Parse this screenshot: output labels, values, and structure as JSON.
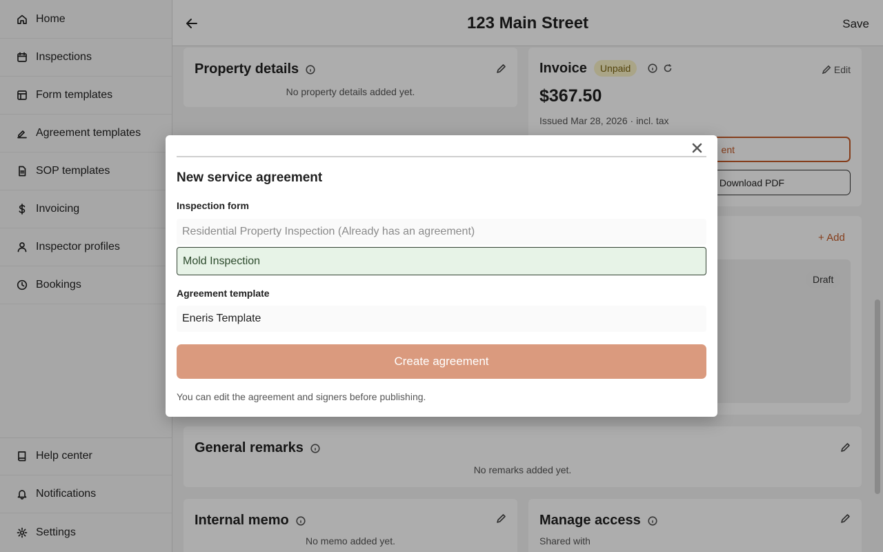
{
  "sidebar": {
    "items": [
      {
        "label": "Home",
        "icon": "home-icon"
      },
      {
        "label": "Inspections",
        "icon": "calendar-icon"
      },
      {
        "label": "Form templates",
        "icon": "layout-icon"
      },
      {
        "label": "Agreement templates",
        "icon": "signature-icon"
      },
      {
        "label": "SOP templates",
        "icon": "document-icon"
      },
      {
        "label": "Invoicing",
        "icon": "dollar-icon"
      },
      {
        "label": "Inspector profiles",
        "icon": "user-icon"
      },
      {
        "label": "Bookings",
        "icon": "clock-icon"
      }
    ],
    "bottom_items": [
      {
        "label": "Help center",
        "icon": "book-icon"
      },
      {
        "label": "Notifications",
        "icon": "bell-icon"
      },
      {
        "label": "Settings",
        "icon": "gear-icon"
      }
    ]
  },
  "topbar": {
    "title": "123 Main Street",
    "save_label": "Save"
  },
  "property_details": {
    "title": "Property details",
    "empty": "No property details added yet."
  },
  "invoice": {
    "title": "Invoice",
    "status": "Unpaid",
    "edit_label": "Edit",
    "amount": "$367.50",
    "meta": "Issued Mar 28, 2026 · incl. tax",
    "action_partial": "ent",
    "download_label": "Download PDF"
  },
  "agreements": {
    "add_label": "+ Add",
    "status": "Draft"
  },
  "general_remarks": {
    "title": "General remarks",
    "empty": "No remarks added yet."
  },
  "internal_memo": {
    "title": "Internal memo",
    "empty": "No memo added yet."
  },
  "manage_access": {
    "title": "Manage access",
    "shared_with": "Shared with"
  },
  "modal": {
    "title": "New service agreement",
    "inspection_form_label": "Inspection form",
    "options": [
      "Residential Property Inspection (Already has an agreement)",
      "Mold Inspection"
    ],
    "template_label": "Agreement template",
    "template_value": "Eneris Template",
    "create_label": "Create agreement",
    "hint": "You can edit the agreement and signers before publishing."
  },
  "colors": {
    "accent": "#c45a28",
    "create_button": "#da9a7e",
    "selected_option_bg": "#e7f3e7",
    "unpaid_badge_bg": "#fbf3c8"
  }
}
